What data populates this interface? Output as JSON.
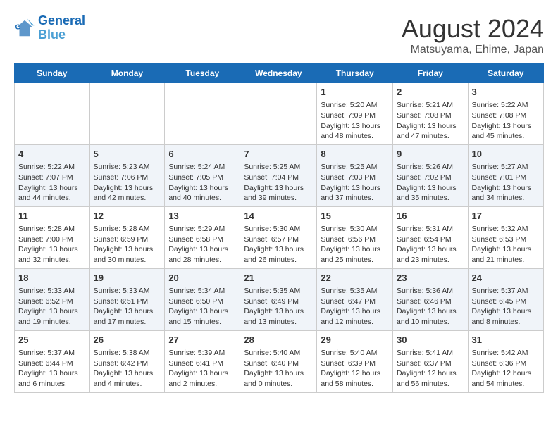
{
  "header": {
    "logo_line1": "General",
    "logo_line2": "Blue",
    "title": "August 2024",
    "subtitle": "Matsuyama, Ehime, Japan"
  },
  "days_of_week": [
    "Sunday",
    "Monday",
    "Tuesday",
    "Wednesday",
    "Thursday",
    "Friday",
    "Saturday"
  ],
  "weeks": [
    [
      {
        "date": "",
        "info": ""
      },
      {
        "date": "",
        "info": ""
      },
      {
        "date": "",
        "info": ""
      },
      {
        "date": "",
        "info": ""
      },
      {
        "date": "1",
        "info": "Sunrise: 5:20 AM\nSunset: 7:09 PM\nDaylight: 13 hours\nand 48 minutes."
      },
      {
        "date": "2",
        "info": "Sunrise: 5:21 AM\nSunset: 7:08 PM\nDaylight: 13 hours\nand 47 minutes."
      },
      {
        "date": "3",
        "info": "Sunrise: 5:22 AM\nSunset: 7:08 PM\nDaylight: 13 hours\nand 45 minutes."
      }
    ],
    [
      {
        "date": "4",
        "info": "Sunrise: 5:22 AM\nSunset: 7:07 PM\nDaylight: 13 hours\nand 44 minutes."
      },
      {
        "date": "5",
        "info": "Sunrise: 5:23 AM\nSunset: 7:06 PM\nDaylight: 13 hours\nand 42 minutes."
      },
      {
        "date": "6",
        "info": "Sunrise: 5:24 AM\nSunset: 7:05 PM\nDaylight: 13 hours\nand 40 minutes."
      },
      {
        "date": "7",
        "info": "Sunrise: 5:25 AM\nSunset: 7:04 PM\nDaylight: 13 hours\nand 39 minutes."
      },
      {
        "date": "8",
        "info": "Sunrise: 5:25 AM\nSunset: 7:03 PM\nDaylight: 13 hours\nand 37 minutes."
      },
      {
        "date": "9",
        "info": "Sunrise: 5:26 AM\nSunset: 7:02 PM\nDaylight: 13 hours\nand 35 minutes."
      },
      {
        "date": "10",
        "info": "Sunrise: 5:27 AM\nSunset: 7:01 PM\nDaylight: 13 hours\nand 34 minutes."
      }
    ],
    [
      {
        "date": "11",
        "info": "Sunrise: 5:28 AM\nSunset: 7:00 PM\nDaylight: 13 hours\nand 32 minutes."
      },
      {
        "date": "12",
        "info": "Sunrise: 5:28 AM\nSunset: 6:59 PM\nDaylight: 13 hours\nand 30 minutes."
      },
      {
        "date": "13",
        "info": "Sunrise: 5:29 AM\nSunset: 6:58 PM\nDaylight: 13 hours\nand 28 minutes."
      },
      {
        "date": "14",
        "info": "Sunrise: 5:30 AM\nSunset: 6:57 PM\nDaylight: 13 hours\nand 26 minutes."
      },
      {
        "date": "15",
        "info": "Sunrise: 5:30 AM\nSunset: 6:56 PM\nDaylight: 13 hours\nand 25 minutes."
      },
      {
        "date": "16",
        "info": "Sunrise: 5:31 AM\nSunset: 6:54 PM\nDaylight: 13 hours\nand 23 minutes."
      },
      {
        "date": "17",
        "info": "Sunrise: 5:32 AM\nSunset: 6:53 PM\nDaylight: 13 hours\nand 21 minutes."
      }
    ],
    [
      {
        "date": "18",
        "info": "Sunrise: 5:33 AM\nSunset: 6:52 PM\nDaylight: 13 hours\nand 19 minutes."
      },
      {
        "date": "19",
        "info": "Sunrise: 5:33 AM\nSunset: 6:51 PM\nDaylight: 13 hours\nand 17 minutes."
      },
      {
        "date": "20",
        "info": "Sunrise: 5:34 AM\nSunset: 6:50 PM\nDaylight: 13 hours\nand 15 minutes."
      },
      {
        "date": "21",
        "info": "Sunrise: 5:35 AM\nSunset: 6:49 PM\nDaylight: 13 hours\nand 13 minutes."
      },
      {
        "date": "22",
        "info": "Sunrise: 5:35 AM\nSunset: 6:47 PM\nDaylight: 13 hours\nand 12 minutes."
      },
      {
        "date": "23",
        "info": "Sunrise: 5:36 AM\nSunset: 6:46 PM\nDaylight: 13 hours\nand 10 minutes."
      },
      {
        "date": "24",
        "info": "Sunrise: 5:37 AM\nSunset: 6:45 PM\nDaylight: 13 hours\nand 8 minutes."
      }
    ],
    [
      {
        "date": "25",
        "info": "Sunrise: 5:37 AM\nSunset: 6:44 PM\nDaylight: 13 hours\nand 6 minutes."
      },
      {
        "date": "26",
        "info": "Sunrise: 5:38 AM\nSunset: 6:42 PM\nDaylight: 13 hours\nand 4 minutes."
      },
      {
        "date": "27",
        "info": "Sunrise: 5:39 AM\nSunset: 6:41 PM\nDaylight: 13 hours\nand 2 minutes."
      },
      {
        "date": "28",
        "info": "Sunrise: 5:40 AM\nSunset: 6:40 PM\nDaylight: 13 hours\nand 0 minutes."
      },
      {
        "date": "29",
        "info": "Sunrise: 5:40 AM\nSunset: 6:39 PM\nDaylight: 12 hours\nand 58 minutes."
      },
      {
        "date": "30",
        "info": "Sunrise: 5:41 AM\nSunset: 6:37 PM\nDaylight: 12 hours\nand 56 minutes."
      },
      {
        "date": "31",
        "info": "Sunrise: 5:42 AM\nSunset: 6:36 PM\nDaylight: 12 hours\nand 54 minutes."
      }
    ]
  ]
}
